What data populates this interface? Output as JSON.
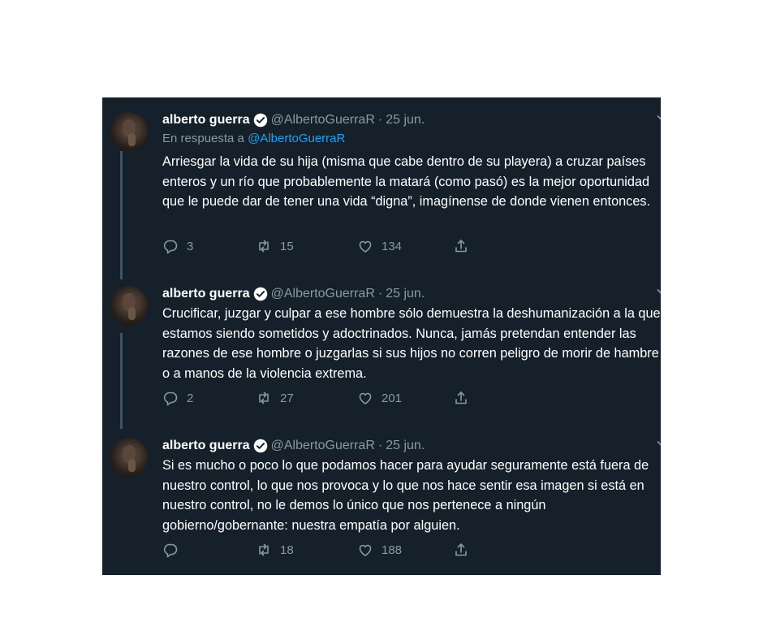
{
  "tweets": [
    {
      "name": "alberto guerra",
      "handle": "@AlbertoGuerraR",
      "separator": "·",
      "date": "25 jun.",
      "reply_prefix": "En respuesta a",
      "reply_handle": "@AlbertoGuerraR",
      "text": "Arriesgar la vida de su hija (misma que cabe dentro de su playera) a cruzar países enteros y un río que probablemente la matará (como pasó) es la mejor oportunidad que le puede dar de tener una vida “digna”, imagínense de donde vienen entonces.",
      "replies": "3",
      "retweets": "15",
      "likes": "134"
    },
    {
      "name": "alberto guerra",
      "handle": "@AlbertoGuerraR",
      "separator": "·",
      "date": "25 jun.",
      "text": "Crucificar, juzgar y culpar a ese hombre sólo demuestra la deshumanización a la que estamos siendo sometidos y adoctrinados. Nunca, jamás pretendan entender las razones de ese hombre o juzgarlas si sus hijos no corren peligro de morir de hambre o a manos de la violencia extrema.",
      "replies": "2",
      "retweets": "27",
      "likes": "201"
    },
    {
      "name": "alberto guerra",
      "handle": "@AlbertoGuerraR",
      "separator": "·",
      "date": "25 jun.",
      "text": "Si es mucho o poco lo que podamos hacer para ayudar seguramente está fuera de nuestro control, lo que nos provoca y lo que nos hace sentir esa imagen si está en nuestro control, no le demos lo único que nos pertenece a ningún gobierno/gobernante: nuestra empatía por alguien.",
      "replies": "",
      "retweets": "18",
      "likes": "188"
    }
  ],
  "icons": [
    "avatar",
    "verified-badge-icon",
    "chevron-down-icon",
    "reply-icon",
    "retweet-icon",
    "like-icon",
    "share-icon"
  ],
  "colors": {
    "background": "#15202b",
    "text": "#ffffff",
    "secondary": "#8899a6",
    "accent": "#1da1f2",
    "thread_line": "#3d5466"
  }
}
